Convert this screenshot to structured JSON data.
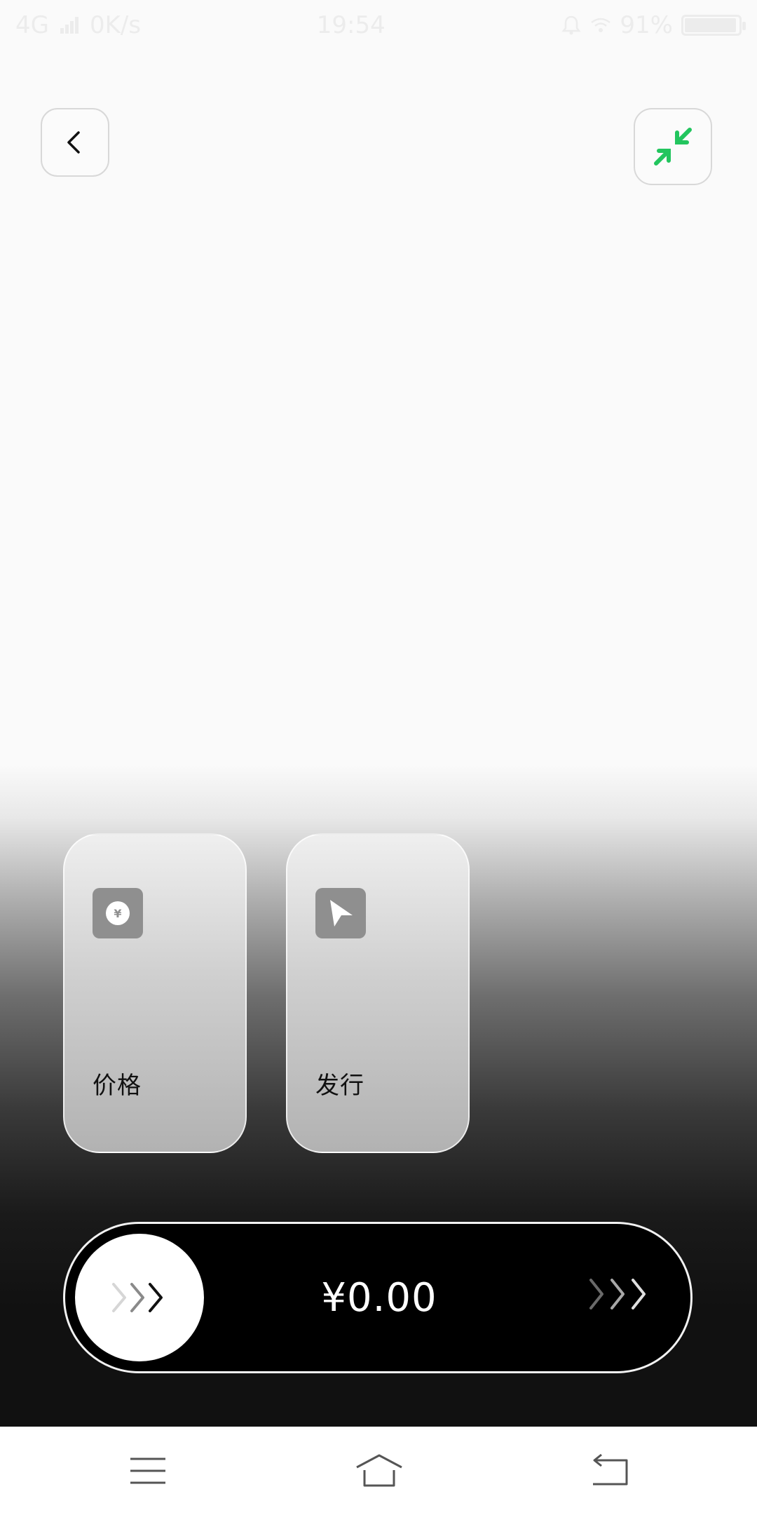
{
  "status_bar": {
    "network": "4G",
    "speed": "0K/s",
    "time": "19:54",
    "battery": "91%",
    "battery_level": 0.91
  },
  "header": {
    "back_icon": "chevron-left-icon",
    "shrink_icon": "minimize-arrows-icon",
    "accent_color": "#22c55e"
  },
  "cards": [
    {
      "label": "价格",
      "icon": "yuan-coin-icon"
    },
    {
      "label": "发行",
      "icon": "send-arrow-icon"
    }
  ],
  "payment": {
    "amount": "¥0.00"
  },
  "nav": {
    "menu_icon": "menu-icon",
    "home_icon": "home-icon",
    "back_icon": "return-icon"
  }
}
